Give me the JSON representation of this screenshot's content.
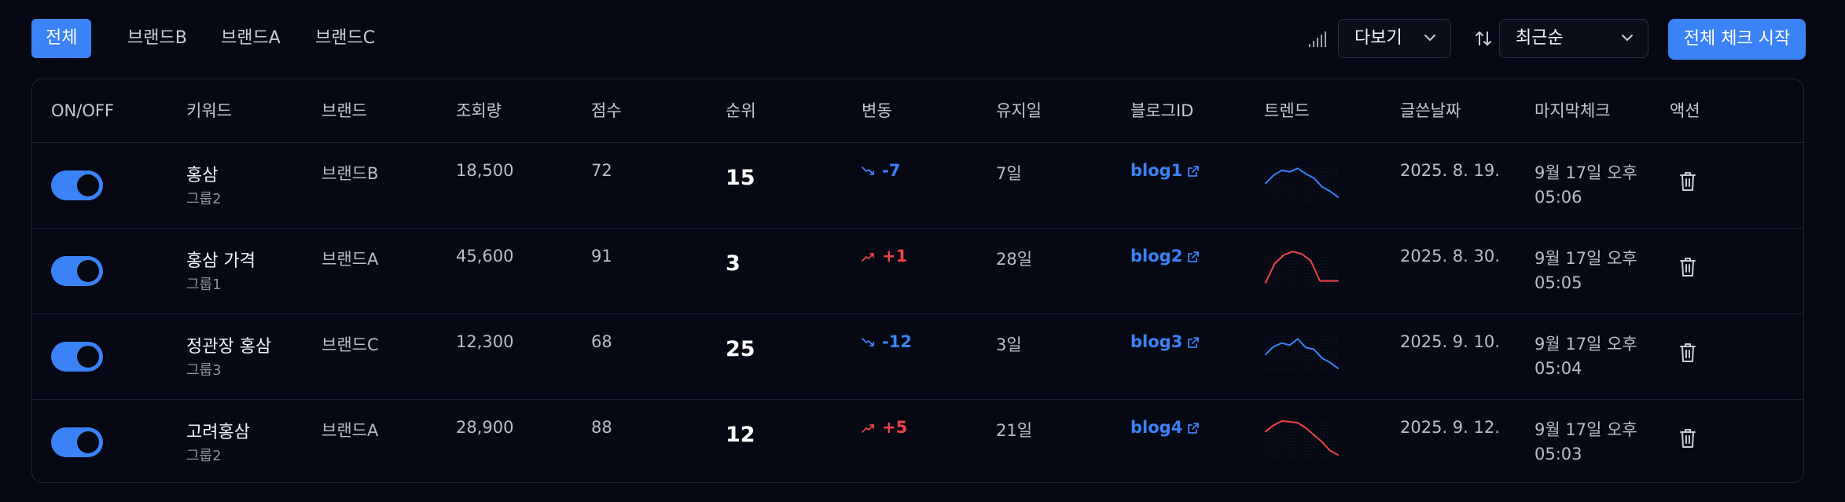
{
  "tabs": [
    {
      "label": "전체",
      "active": true
    },
    {
      "label": "브랜드B",
      "active": false
    },
    {
      "label": "브랜드A",
      "active": false
    },
    {
      "label": "브랜드C",
      "active": false
    }
  ],
  "view_select": {
    "label": "다보기",
    "icon": "signal-bars-icon"
  },
  "sort_select": {
    "label": "최근순",
    "icon": "sort-arrows-icon"
  },
  "start_button": {
    "label": "전체 체크 시작"
  },
  "columns": [
    "ON/OFF",
    "키워드",
    "브랜드",
    "조회량",
    "점수",
    "순위",
    "변동",
    "유지일",
    "블로그ID",
    "트렌드",
    "글쓴날짜",
    "마지막체크",
    "액션"
  ],
  "rows": [
    {
      "on": true,
      "keyword": "홍삼",
      "group": "그룹2",
      "brand": "브랜드B",
      "views": "18,500",
      "score": "72",
      "rank": "15",
      "change": "-7",
      "change_dir": "down",
      "days": "7일",
      "blog": "blog1",
      "trend": [
        0.45,
        0.68,
        0.82,
        0.78,
        0.88,
        0.72,
        0.6,
        0.35,
        0.22,
        0.05
      ],
      "written": "2025. 8. 19.",
      "last_check_1": "9월 17일 오후",
      "last_check_2": "05:06"
    },
    {
      "on": true,
      "keyword": "홍삼 가격",
      "group": "그룹1",
      "brand": "브랜드A",
      "views": "45,600",
      "score": "91",
      "rank": "3",
      "change": "+1",
      "change_dir": "up",
      "days": "28일",
      "blog": "blog2",
      "trend": [
        0.05,
        0.6,
        0.85,
        0.95,
        0.88,
        0.68,
        0.1,
        0.1,
        0.1
      ],
      "written": "2025. 8. 30.",
      "last_check_1": "9월 17일 오후",
      "last_check_2": "05:05"
    },
    {
      "on": true,
      "keyword": "정관장 홍삼",
      "group": "그룹3",
      "brand": "브랜드C",
      "views": "12,300",
      "score": "68",
      "rank": "25",
      "change": "-12",
      "change_dir": "down",
      "days": "3일",
      "blog": "blog3",
      "trend": [
        0.45,
        0.68,
        0.78,
        0.72,
        0.9,
        0.65,
        0.6,
        0.35,
        0.22,
        0.05
      ],
      "written": "2025. 9. 10.",
      "last_check_1": "9월 17일 오후",
      "last_check_2": "05:04"
    },
    {
      "on": true,
      "keyword": "고려홍삼",
      "group": "그룹2",
      "brand": "브랜드A",
      "views": "28,900",
      "score": "88",
      "rank": "12",
      "change": "+5",
      "change_dir": "up",
      "days": "21일",
      "blog": "blog4",
      "trend": [
        0.7,
        0.88,
        1.0,
        0.98,
        0.95,
        0.8,
        0.6,
        0.4,
        0.15,
        0.02
      ],
      "written": "2025. 9. 12.",
      "last_check_1": "9월 17일 오후",
      "last_check_2": "05:03"
    }
  ],
  "colors": {
    "accent": "#3b82f6",
    "up": "#ef4444",
    "down": "#3b82f6",
    "background": "#060913"
  }
}
